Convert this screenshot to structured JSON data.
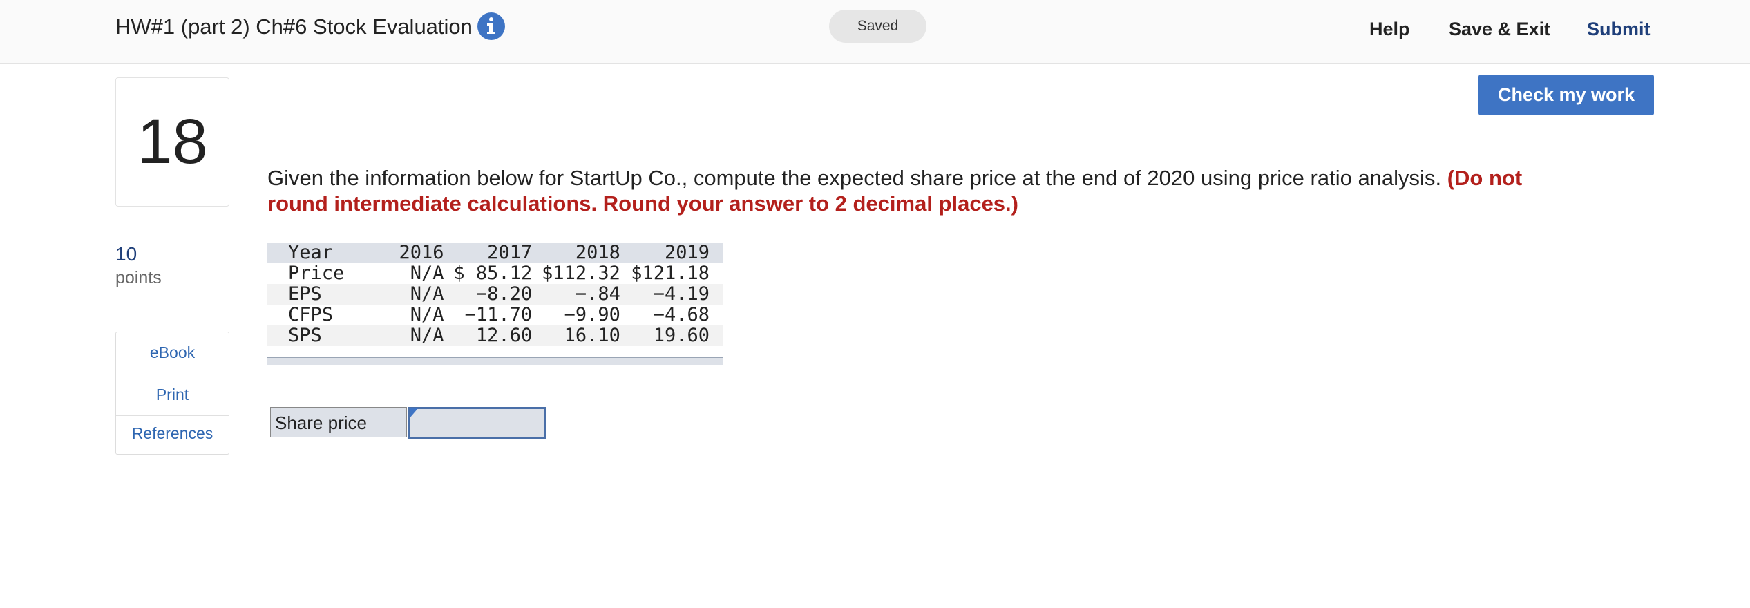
{
  "header": {
    "assignment_title": "HW#1 (part 2) Ch#6 Stock Evaluation",
    "info_icon": "info-circle-icon",
    "save_status": "Saved",
    "nav": {
      "help_label": "Help",
      "save_exit_label": "Save & Exit",
      "submit_label": "Submit"
    }
  },
  "question": {
    "number": "18",
    "points_value": "10",
    "points_label": "points",
    "resources": {
      "ebook_label": "eBook",
      "print_label": "Print",
      "references_label": "References"
    },
    "check_button_label": "Check my work",
    "prompt": "Given the information below for StartUp Co., compute the expected share price at the end of 2020 using price ratio analysis.",
    "instruction": "(Do not round intermediate calculations. Round your answer to 2 decimal places.)",
    "data_table": {
      "header": {
        "label": "Year",
        "y2016": "2016",
        "y2017": "2017",
        "y2018": "2018",
        "y2019": "2019"
      },
      "rows": [
        {
          "label": "Price",
          "y2016": "N/A",
          "y2017": "$ 85.12",
          "y2018": "$112.32",
          "y2019": "$121.18"
        },
        {
          "label": "EPS",
          "y2016": "N/A",
          "y2017": "−8.20",
          "y2018": "−.84",
          "y2019": "−4.19"
        },
        {
          "label": "CFPS",
          "y2016": "N/A",
          "y2017": "−11.70",
          "y2018": "−9.90",
          "y2019": "−4.68"
        },
        {
          "label": "SPS",
          "y2016": "N/A",
          "y2017": "12.60",
          "y2018": "16.10",
          "y2019": "19.60"
        }
      ]
    },
    "answer": {
      "label": "Share price",
      "value": ""
    }
  },
  "colors": {
    "accent_blue": "#3e74c4",
    "instruction_red": "#b3201c",
    "submit_navy": "#1f3f7a",
    "table_header_bg": "#dde1e8"
  }
}
